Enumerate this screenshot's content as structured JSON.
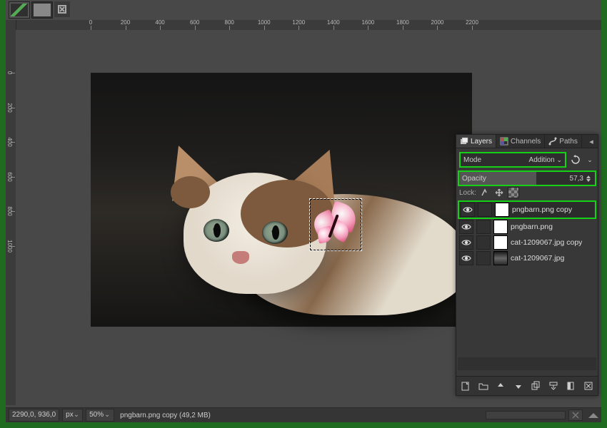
{
  "ruler_ticks": [
    "0",
    "200",
    "400",
    "600",
    "800",
    "1000",
    "1200",
    "1400",
    "1600",
    "1800",
    "2000",
    "2200"
  ],
  "ruler_vticks": [
    "0",
    "200",
    "400",
    "600",
    "800",
    "1000"
  ],
  "status": {
    "coords": "2290,0, 936,0",
    "units": "px",
    "zoom": "50%",
    "title": "pngbarn.png copy (49,2 MB)"
  },
  "panel": {
    "tabs": {
      "layers": "Layers",
      "channels": "Channels",
      "paths": "Paths"
    },
    "mode": {
      "label": "Mode",
      "value": "Addition"
    },
    "opacity": {
      "label": "Opacity",
      "value": "57,3"
    },
    "lock_label": "Lock:",
    "layers": [
      {
        "name": "pngbarn.png copy",
        "selected": true,
        "thumb": "trans"
      },
      {
        "name": "pngbarn.png",
        "selected": false,
        "thumb": "trans"
      },
      {
        "name": "cat-1209067.jpg copy",
        "selected": false,
        "thumb": "white"
      },
      {
        "name": "cat-1209067.jpg",
        "selected": false,
        "thumb": "photo"
      }
    ]
  }
}
